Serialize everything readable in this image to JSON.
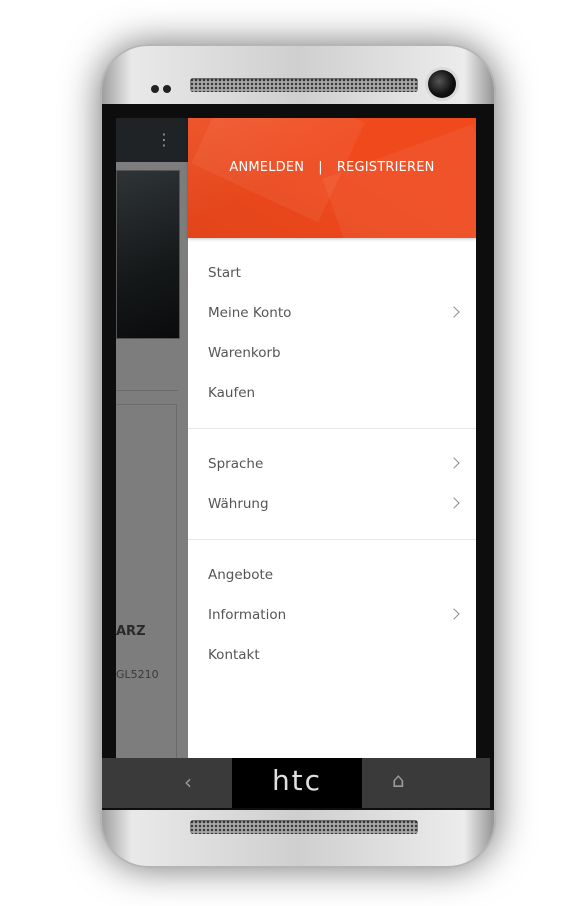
{
  "device": {
    "brand": "htc"
  },
  "background_app": {
    "product_title_fragment": "ARZ",
    "product_sku_fragment": "GL5210",
    "menu_icon": "overflow-menu-icon"
  },
  "drawer": {
    "header": {
      "login_label": "ANMELDEN",
      "separator": "|",
      "register_label": "REGISTRIEREN",
      "color": "#f0491c"
    },
    "groups": [
      {
        "items": [
          {
            "label": "Start",
            "has_submenu": false
          },
          {
            "label": "Meine Konto",
            "has_submenu": true
          },
          {
            "label": "Warenkorb",
            "has_submenu": false
          },
          {
            "label": "Kaufen",
            "has_submenu": false
          }
        ]
      },
      {
        "items": [
          {
            "label": "Sprache",
            "has_submenu": true
          },
          {
            "label": "Währung",
            "has_submenu": true
          }
        ]
      },
      {
        "items": [
          {
            "label": "Angebote",
            "has_submenu": false
          },
          {
            "label": "Information",
            "has_submenu": true
          },
          {
            "label": "Kontakt",
            "has_submenu": false
          }
        ]
      }
    ]
  },
  "navbar": {
    "back_icon": "back-icon",
    "home_icon": "home-icon"
  }
}
